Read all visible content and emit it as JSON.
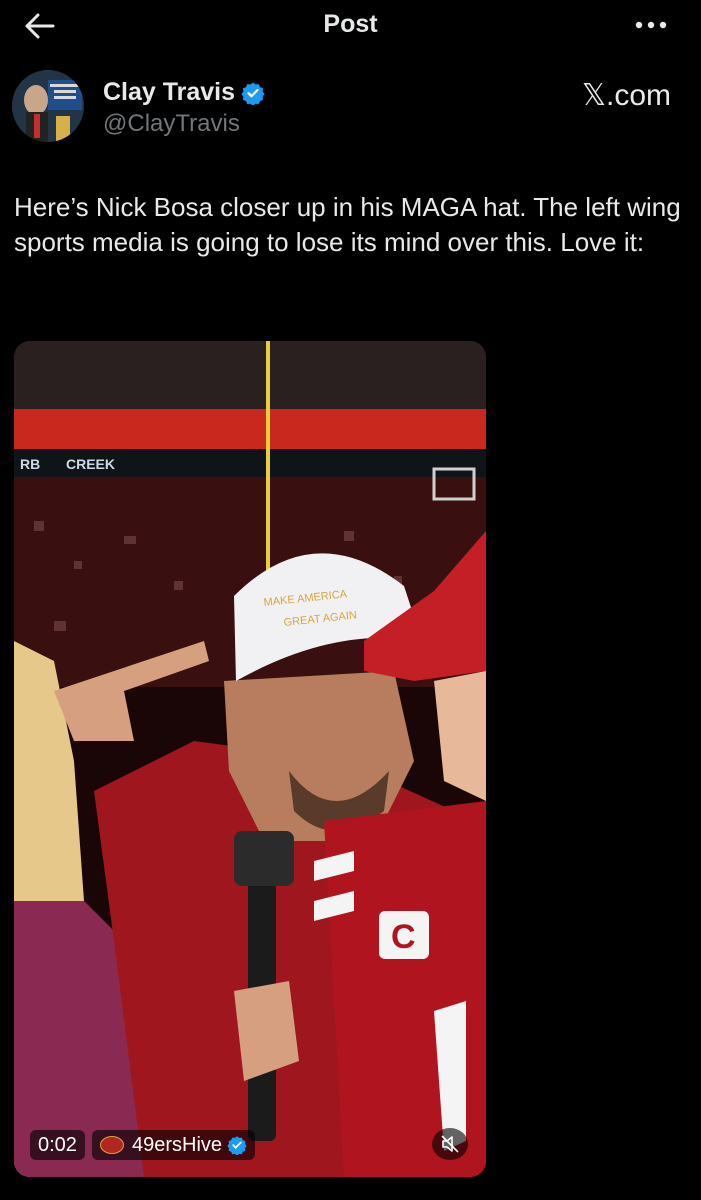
{
  "header": {
    "title": "Post",
    "back_icon": "arrow-left-icon",
    "more_icon": "more-horizontal-icon"
  },
  "author": {
    "display_name": "Clay Travis",
    "handle": "@ClayTravis",
    "verified": true,
    "avatar_sign_text": "I HATE YOU CLAY TRAVIS"
  },
  "source": {
    "label": "𝕏.com"
  },
  "tweet": {
    "text": "Here’s Nick Bosa closer up in his MAGA hat. The left wing sports media is going to lose its mind over this. Love it:"
  },
  "video": {
    "timestamp": "0:02",
    "attribution": "49ersHive",
    "attribution_verified": true,
    "mute_icon": "volume-muted-icon",
    "jersey_patch": "C",
    "stadium_sign": "CREEK"
  },
  "colors": {
    "background": "#000000",
    "text_primary": "#e7e9ea",
    "text_secondary": "#71767b",
    "verified_blue": "#1d9bf0",
    "niners_red": "#aa0000"
  }
}
